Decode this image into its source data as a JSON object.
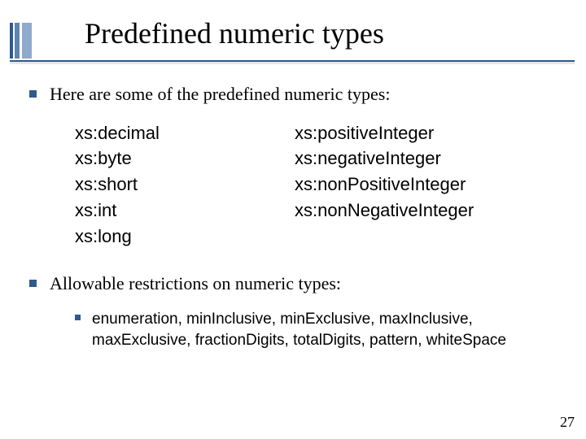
{
  "title": "Predefined numeric types",
  "bullets": {
    "b1": "Here are some of the predefined numeric types:",
    "b2": "Allowable restrictions on numeric types:"
  },
  "types_left": {
    "t0": "xs:decimal",
    "t1": "xs:byte",
    "t2": "xs:short",
    "t3": "xs:int",
    "t4": "xs:long"
  },
  "types_right": {
    "t0": "xs:positiveInteger",
    "t1": "xs:negativeInteger",
    "t2": "xs:nonPositiveInteger",
    "t3": "xs:nonNegativeInteger"
  },
  "restrictions": "enumeration, minInclusive, minExclusive, maxInclusive, maxExclusive, fractionDigits, totalDigits, pattern, whiteSpace",
  "page_number": "27"
}
